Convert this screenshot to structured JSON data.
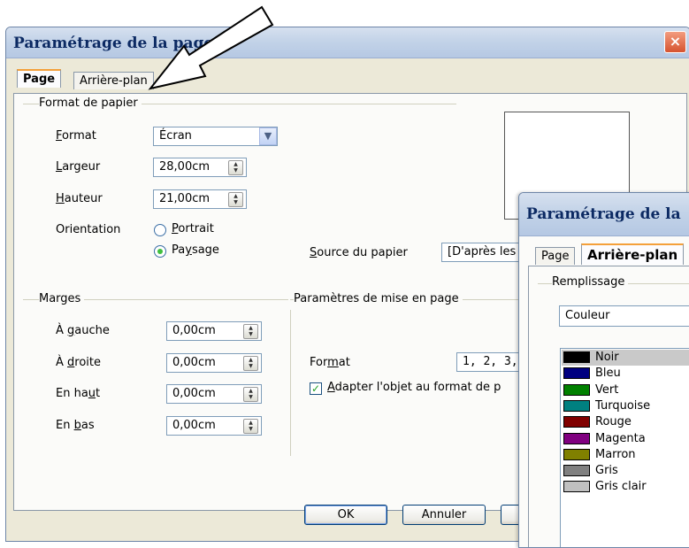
{
  "main": {
    "title": "Paramétrage de la page",
    "close": "×",
    "tabs": [
      "Page",
      "Arrière-plan"
    ],
    "paper_group": "Format de papier",
    "format": {
      "pre": "",
      "ak": "F",
      "post": "ormat",
      "value": "Écran"
    },
    "width": {
      "pre": "",
      "ak": "L",
      "post": "argeur",
      "value": "28,00cm"
    },
    "height": {
      "pre": "",
      "ak": "H",
      "post": "auteur",
      "value": "21,00cm"
    },
    "orientation_label": "Orientation",
    "portrait": {
      "pre": "",
      "ak": "P",
      "post": "ortrait"
    },
    "landscape": {
      "pre": "Pa",
      "ak": "y",
      "post": "sage"
    },
    "paper_source": {
      "pre": "",
      "ak": "S",
      "post": "ource du papier",
      "value": "[D'après les"
    },
    "margins_group": "Marges",
    "left": {
      "pre": "À ",
      "ak": "g",
      "post": "auche",
      "value": "0,00cm"
    },
    "right": {
      "pre": "À ",
      "ak": "d",
      "post": "roite",
      "value": "0,00cm"
    },
    "top": {
      "pre": "En ha",
      "ak": "u",
      "post": "t",
      "value": "0,00cm"
    },
    "bottom": {
      "pre": "En ",
      "ak": "b",
      "post": "as",
      "value": "0,00cm"
    },
    "layout_group": "Paramètres de mise en page",
    "layout_format": {
      "pre": "For",
      "ak": "m",
      "post": "at",
      "value": "1, 2, 3, .."
    },
    "fit_object": {
      "pre": "",
      "ak": "A",
      "post": "dapter l'objet au format de p"
    },
    "buttons": {
      "ok": "OK",
      "cancel": "Annuler"
    }
  },
  "overlay": {
    "title": "Paramétrage de la",
    "tabs": [
      "Page",
      "Arrière-plan"
    ],
    "fill_group": "Remplissage",
    "fill_type": "Couleur",
    "colors": [
      {
        "name": "Noir",
        "hex": "#000000"
      },
      {
        "name": "Bleu",
        "hex": "#000080"
      },
      {
        "name": "Vert",
        "hex": "#008000"
      },
      {
        "name": "Turquoise",
        "hex": "#008080"
      },
      {
        "name": "Rouge",
        "hex": "#800000"
      },
      {
        "name": "Magenta",
        "hex": "#800080"
      },
      {
        "name": "Marron",
        "hex": "#808000"
      },
      {
        "name": "Gris",
        "hex": "#808080"
      },
      {
        "name": "Gris clair",
        "hex": "#c0c0c0"
      }
    ],
    "selected_color": "Noir"
  },
  "icons": {
    "close": "close-icon",
    "dropdown": "chevron-down-icon",
    "spin": "spin-updown-icon",
    "pointer": "callout-arrow"
  }
}
